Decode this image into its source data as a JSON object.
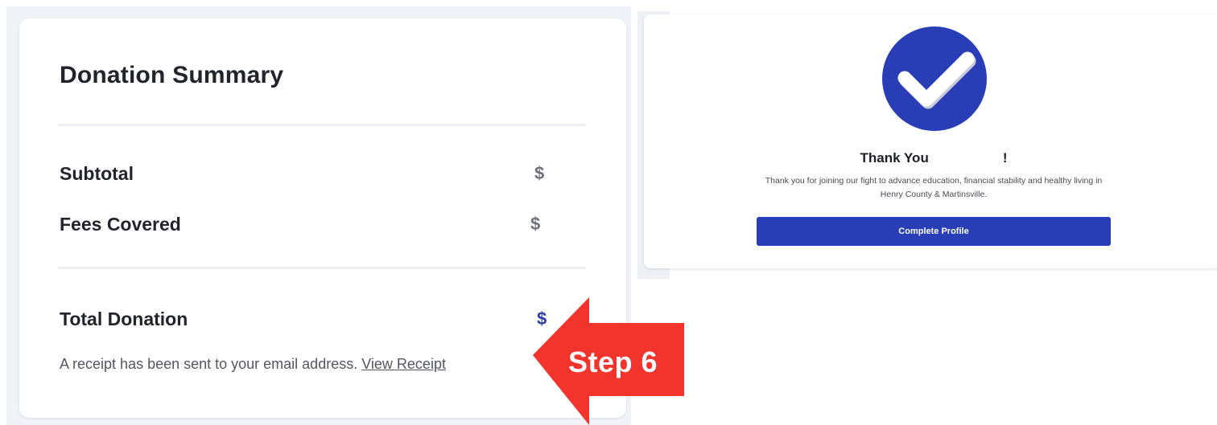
{
  "summary": {
    "title": "Donation Summary",
    "subtotal_label": "Subtotal",
    "subtotal_value": "$",
    "fees_label": "Fees Covered",
    "fees_value": "$",
    "total_label": "Total Donation",
    "total_value": "$",
    "receipt_text": "A receipt has been sent to your email address.",
    "receipt_link": "View Receipt"
  },
  "annotation": {
    "step_label": "Step 6",
    "arrow_color": "#f2342c",
    "arrow_icon": "left-arrow-icon"
  },
  "thanks": {
    "heading_prefix": "Thank You",
    "heading_suffix": "!",
    "message": "Thank you for joining our fight to advance education, financial stability and healthy living in Henry County & Martinsville.",
    "button_label": "Complete Profile",
    "badge_icon": "checkmark-icon",
    "accent_color": "#283db6"
  }
}
